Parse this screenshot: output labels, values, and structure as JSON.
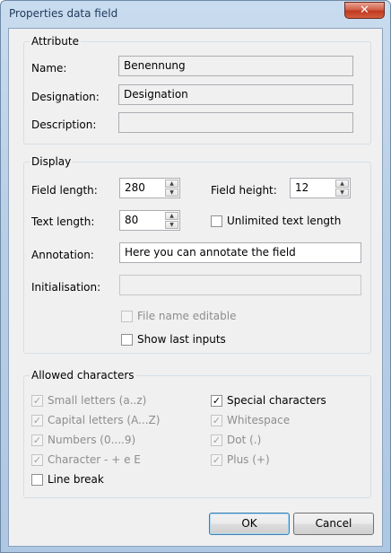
{
  "window": {
    "title": "Properties data field",
    "close_glyph": "✕"
  },
  "attribute": {
    "title": "Attribute",
    "name_label": "Name:",
    "name_value": "Benennung",
    "designation_label": "Designation:",
    "designation_value": "Designation",
    "description_label": "Description:",
    "description_value": ""
  },
  "display": {
    "title": "Display",
    "field_length_label": "Field length:",
    "field_length_value": "280",
    "field_height_label": "Field height:",
    "field_height_value": "12",
    "text_length_label": "Text length:",
    "text_length_value": "80",
    "unlimited_label": "Unlimited text length",
    "unlimited_checked": false,
    "annotation_label": "Annotation:",
    "annotation_value": "Here you can annotate the field",
    "initialisation_label": "Initialisation:",
    "initialisation_value": "",
    "file_name_editable_label": "File name editable",
    "show_last_inputs_label": "Show last inputs"
  },
  "allowed": {
    "title": "Allowed characters",
    "items": [
      {
        "label": "Small letters (a..z)",
        "checked": true,
        "enabled": false
      },
      {
        "label": "Capital letters (A...Z)",
        "checked": true,
        "enabled": false
      },
      {
        "label": "Numbers (0....9)",
        "checked": true,
        "enabled": false
      },
      {
        "label": "Character - + e E",
        "checked": true,
        "enabled": false
      },
      {
        "label": "Line break",
        "checked": false,
        "enabled": true
      },
      {
        "label": "Special characters",
        "checked": true,
        "enabled": true
      },
      {
        "label": "Whitespace",
        "checked": true,
        "enabled": false
      },
      {
        "label": "Dot (.)",
        "checked": true,
        "enabled": false
      },
      {
        "label": "Plus (+)",
        "checked": true,
        "enabled": false
      }
    ],
    "check_glyph": "✓"
  },
  "buttons": {
    "ok": "OK",
    "cancel": "Cancel"
  }
}
